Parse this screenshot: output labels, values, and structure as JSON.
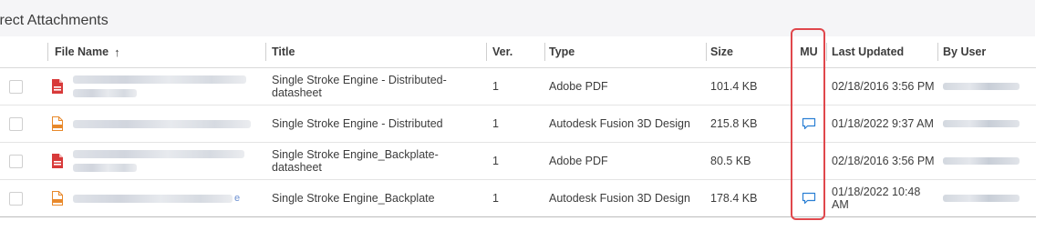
{
  "section": {
    "title": "irect Attachments"
  },
  "columns": {
    "file_name": "File Name",
    "sort_arrow": "↑",
    "title": "Title",
    "ver": "Ver.",
    "type": "Type",
    "size": "Size",
    "mu": "MU",
    "last_updated": "Last Updated",
    "by_user": "By User"
  },
  "rows": [
    {
      "icon": "pdf-file-icon",
      "blur_suffix": "",
      "title": "Single Stroke Engine - Distributed-datasheet",
      "ver": "1",
      "type": "Adobe PDF",
      "size": "101.4 KB",
      "has_markup": false,
      "last_updated": "02/18/2016 3:56 PM"
    },
    {
      "icon": "f3d-file-icon",
      "blur_suffix": "",
      "title": "Single Stroke Engine - Distributed",
      "ver": "1",
      "type": "Autodesk Fusion 3D Design",
      "size": "215.8 KB",
      "has_markup": true,
      "last_updated": "01/18/2022 9:37 AM"
    },
    {
      "icon": "pdf-file-icon",
      "blur_suffix": "",
      "title": "Single Stroke Engine_Backplate-datasheet",
      "ver": "1",
      "type": "Adobe PDF",
      "size": "80.5 KB",
      "has_markup": false,
      "last_updated": "02/18/2016 3:56 PM"
    },
    {
      "icon": "f3d-file-icon",
      "blur_suffix": "e",
      "title": "Single Stroke Engine_Backplate",
      "ver": "1",
      "type": "Autodesk Fusion 3D Design",
      "size": "178.4 KB",
      "has_markup": true,
      "last_updated": "01/18/2022 10:48 AM"
    }
  ],
  "colors": {
    "pdf_icon": "#d83a3a",
    "f3d_icon": "#e8892b",
    "comment_icon": "#2a7fd4",
    "highlight": "#e0474c",
    "header_bg": "#f5f5f7"
  }
}
